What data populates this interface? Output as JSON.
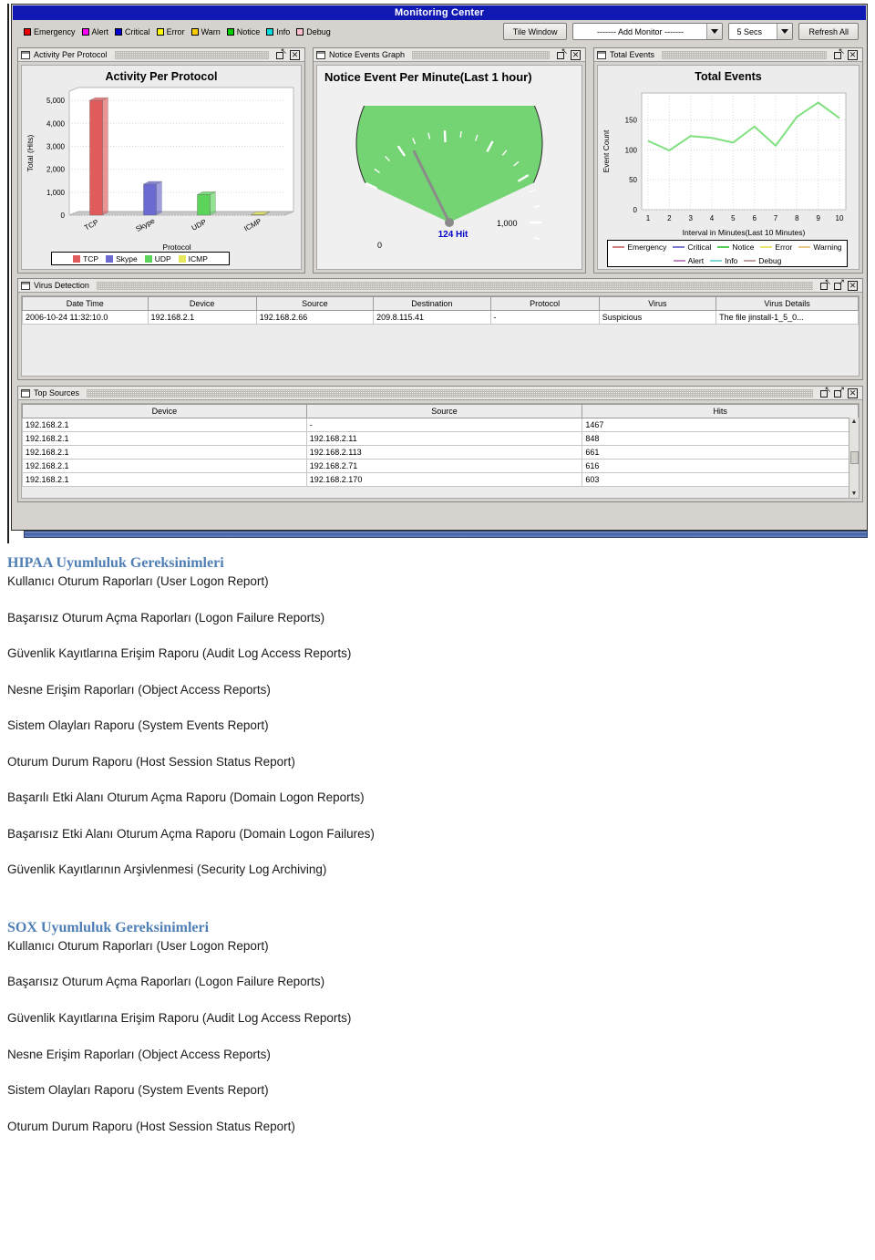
{
  "window": {
    "title": "Monitoring Center"
  },
  "toolbar": {
    "severity_legend": [
      {
        "label": "Emergency",
        "color": "#ee0000"
      },
      {
        "label": "Alert",
        "color": "#ff00ff"
      },
      {
        "label": "Critical",
        "color": "#0000cc"
      },
      {
        "label": "Error",
        "color": "#ffff00"
      },
      {
        "label": "Warn",
        "color": "#ffcc00"
      },
      {
        "label": "Notice",
        "color": "#00cc00"
      },
      {
        "label": "Info",
        "color": "#00dddd"
      },
      {
        "label": "Debug",
        "color": "#ffc0cb"
      }
    ],
    "tile_window_label": "Tile Window",
    "add_monitor_value": "------- Add Monitor -------",
    "refresh_interval_value": "5 Secs",
    "refresh_all_label": "Refresh All"
  },
  "panels": {
    "activity": {
      "title": "Activity Per Protocol"
    },
    "notice": {
      "title": "Notice Events Graph"
    },
    "total": {
      "title": "Total Events"
    },
    "virus": {
      "title": "Virus Detection"
    },
    "top_sources": {
      "title": "Top Sources"
    }
  },
  "chart_data": [
    {
      "type": "bar",
      "title": "Activity Per Protocol",
      "xlabel": "Protocol",
      "ylabel": "Total (Hits)",
      "categories": [
        "TCP",
        "Skype",
        "UDP",
        "ICMP"
      ],
      "values": [
        5000,
        1350,
        900,
        30
      ],
      "colors": [
        "#e05b5b",
        "#6a6ad0",
        "#5cd45c",
        "#e8e85c"
      ],
      "yticks": [
        "0",
        "1,000",
        "2,000",
        "3,000",
        "4,000",
        "5,000"
      ],
      "ylim": [
        0,
        5400
      ],
      "grid": true,
      "legend_position": "bottom",
      "legend": [
        "TCP",
        "Skype",
        "UDP",
        "ICMP"
      ]
    },
    {
      "type": "gauge",
      "title": "Notice Event Per Minute(Last 1 hour)",
      "value": 124,
      "value_label": "124 Hit",
      "min_label": "0",
      "max_label": "1,000",
      "ylim": [
        0,
        1000
      ],
      "color": "#74d474"
    },
    {
      "type": "line",
      "title": "Total Events",
      "xlabel": "Interval in Minutes(Last 10 Minutes)",
      "ylabel": "Event Count",
      "x": [
        1,
        2,
        3,
        4,
        5,
        6,
        7,
        8,
        9,
        10
      ],
      "series": [
        {
          "name": "Notice",
          "color": "#7fe07f",
          "values": [
            115,
            99,
            123,
            120,
            112,
            139,
            107,
            155,
            179,
            153
          ]
        }
      ],
      "yticks": [
        "0",
        "50",
        "100",
        "150"
      ],
      "ylim": [
        0,
        195
      ],
      "grid": true,
      "legend_position": "bottom",
      "legend": [
        {
          "label": "Emergency",
          "color": "#d08080"
        },
        {
          "label": "Critical",
          "color": "#7a7ad0"
        },
        {
          "label": "Notice",
          "color": "#55cc55"
        },
        {
          "label": "Error",
          "color": "#e8e870"
        },
        {
          "label": "Warning",
          "color": "#e8c98a"
        },
        {
          "label": "Alert",
          "color": "#c08ac0"
        },
        {
          "label": "Info",
          "color": "#7fd8d8"
        },
        {
          "label": "Debug",
          "color": "#c0a0a0"
        }
      ]
    }
  ],
  "virus_table": {
    "columns": [
      "Date Time",
      "Device",
      "Source",
      "Destination",
      "Protocol",
      "Virus",
      "Virus Details"
    ],
    "rows": [
      [
        "2006-10-24 11:32:10.0",
        "192.168.2.1",
        "192.168.2.66",
        "209.8.115.41",
        "-",
        "Suspicious",
        "The file jinstall-1_5_0..."
      ]
    ]
  },
  "top_sources_table": {
    "columns": [
      "Device",
      "Source",
      "Hits"
    ],
    "rows": [
      [
        "192.168.2.1",
        "-",
        "1467"
      ],
      [
        "192.168.2.1",
        "192.168.2.11",
        "848"
      ],
      [
        "192.168.2.1",
        "192.168.2.113",
        "661"
      ],
      [
        "192.168.2.1",
        "192.168.2.71",
        "616"
      ],
      [
        "192.168.2.1",
        "192.168.2.170",
        "603"
      ]
    ]
  },
  "document": {
    "hipaa_heading": "HIPAA Uyumluluk Gereksinimleri",
    "hipaa_items": [
      "Kullanıcı Oturum Raporları (User Logon Report)",
      "Başarısız Oturum Açma Raporları (Logon Failure Reports)",
      "Güvenlik Kayıtlarına Erişim Raporu (Audit Log Access Reports)",
      "Nesne Erişim Raporları (Object Access Reports)",
      "Sistem Olayları Raporu (System Events Report)",
      "Oturum Durum Raporu (Host Session Status Report)",
      "Başarılı Etki Alanı Oturum Açma Raporu (Domain Logon Reports)",
      "Başarısız Etki Alanı Oturum Açma Raporu (Domain Logon Failures)",
      "Güvenlik Kayıtlarının Arşivlenmesi (Security Log Archiving)"
    ],
    "sox_heading": "SOX Uyumluluk Gereksinimleri",
    "sox_items": [
      "Kullanıcı Oturum Raporları (User Logon Report)",
      "Başarısız Oturum Açma Raporları (Logon Failure Reports)",
      "Güvenlik Kayıtlarına Erişim Raporu (Audit Log Access Reports)",
      "Nesne Erişim Raporları (Object Access Reports)",
      "Sistem Olayları Raporu (System Events Report)",
      "Oturum Durum Raporu (Host Session Status Report)"
    ]
  }
}
